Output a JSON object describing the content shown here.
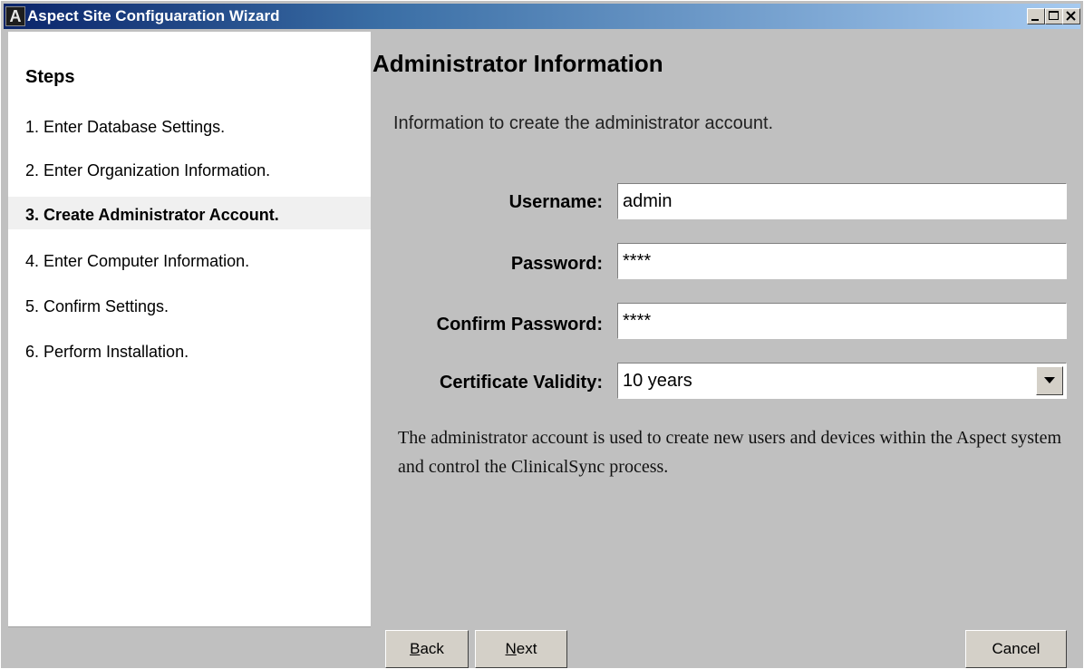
{
  "window": {
    "title": "Aspect Site Configuaration Wizard",
    "icon_letter": "A"
  },
  "sidebar": {
    "title": "Steps",
    "steps": [
      {
        "label": "1. Enter Database Settings."
      },
      {
        "label": "2. Enter Organization Information."
      },
      {
        "label": "3. Create Administrator Account.",
        "active": true
      },
      {
        "label": "4. Enter Computer Information."
      },
      {
        "label": "5. Confirm Settings."
      },
      {
        "label": "6. Perform Installation."
      }
    ]
  },
  "main": {
    "title": "Administrator Information",
    "intro": "Information to create the administrator account.",
    "fields": {
      "username": {
        "label": "Username:",
        "value": "admin"
      },
      "password": {
        "label": "Password:",
        "value": "****"
      },
      "confirm_password": {
        "label": "Confirm Password:",
        "value": "****"
      },
      "certificate_validity": {
        "label": "Certificate Validity:",
        "value": "10 years"
      }
    },
    "description": "The administrator account is used to create new users and devices within the Aspect system and control the ClinicalSync process."
  },
  "buttons": {
    "back_first": "B",
    "back_rest": "ack",
    "next_first": "N",
    "next_rest": "ext",
    "cancel": "Cancel"
  }
}
